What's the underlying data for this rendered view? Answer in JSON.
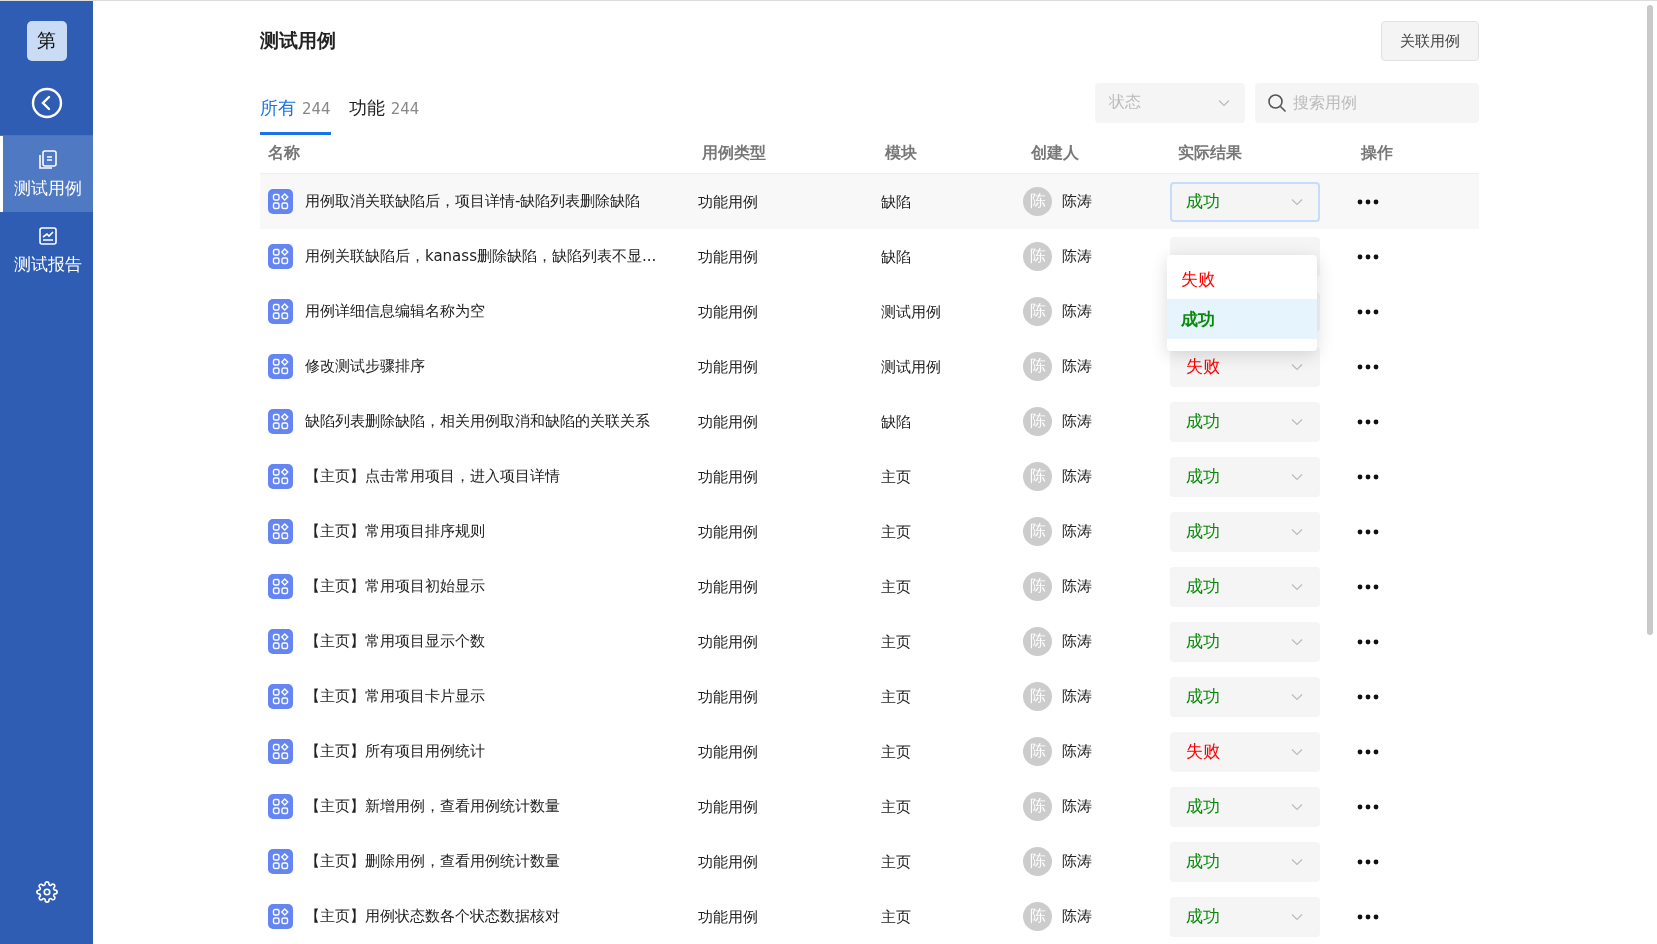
{
  "sidebar": {
    "logo": "第",
    "items": [
      {
        "label": "测试用例",
        "selected": true
      },
      {
        "label": "测试报告",
        "selected": false
      }
    ]
  },
  "header": {
    "title": "测试用例",
    "button": "关联用例"
  },
  "tabs": [
    {
      "label": "所有",
      "count": "244",
      "selected": true
    },
    {
      "label": "功能",
      "count": "244",
      "selected": false
    }
  ],
  "filters": {
    "status": {
      "placeholder": "状态"
    },
    "search": {
      "placeholder": "搜索用例"
    }
  },
  "table": {
    "columns": [
      "名称",
      "用例类型",
      "模块",
      "创建人",
      "实际结果",
      "操作"
    ],
    "rows": [
      {
        "name": "用例取消关联缺陷后，项目详情-缺陷列表删除缺陷",
        "type": "功能用例",
        "module": "缺陷",
        "avatar": "陈",
        "creator": "陈涛",
        "result": {
          "label": "成功",
          "kind": "success"
        },
        "active": true
      },
      {
        "name": "用例关联缺陷后，kanass删除缺陷，缺陷列表不显...",
        "type": "功能用例",
        "module": "缺陷",
        "avatar": "陈",
        "creator": "陈涛",
        "active": false
      },
      {
        "name": "用例详细信息编辑名称为空",
        "type": "功能用例",
        "module": "测试用例",
        "avatar": "陈",
        "creator": "陈涛",
        "active": false
      },
      {
        "name": "修改测试步骤排序",
        "type": "功能用例",
        "module": "测试用例",
        "avatar": "陈",
        "creator": "陈涛",
        "result": {
          "label": "失败",
          "kind": "fail"
        },
        "active": false
      },
      {
        "name": "缺陷列表删除缺陷，相关用例取消和缺陷的关联关系",
        "type": "功能用例",
        "module": "缺陷",
        "avatar": "陈",
        "creator": "陈涛",
        "result": {
          "label": "成功",
          "kind": "success"
        },
        "active": false
      },
      {
        "name": "【主页】点击常用项目，进入项目详情",
        "type": "功能用例",
        "module": "主页",
        "avatar": "陈",
        "creator": "陈涛",
        "result": {
          "label": "成功",
          "kind": "success"
        },
        "active": false
      },
      {
        "name": "【主页】常用项目排序规则",
        "type": "功能用例",
        "module": "主页",
        "avatar": "陈",
        "creator": "陈涛",
        "result": {
          "label": "成功",
          "kind": "success"
        },
        "active": false
      },
      {
        "name": "【主页】常用项目初始显示",
        "type": "功能用例",
        "module": "主页",
        "avatar": "陈",
        "creator": "陈涛",
        "result": {
          "label": "成功",
          "kind": "success"
        },
        "active": false
      },
      {
        "name": "【主页】常用项目显示个数",
        "type": "功能用例",
        "module": "主页",
        "avatar": "陈",
        "creator": "陈涛",
        "result": {
          "label": "成功",
          "kind": "success"
        },
        "active": false
      },
      {
        "name": "【主页】常用项目卡片显示",
        "type": "功能用例",
        "module": "主页",
        "avatar": "陈",
        "creator": "陈涛",
        "result": {
          "label": "成功",
          "kind": "success"
        },
        "active": false
      },
      {
        "name": "【主页】所有项目用例统计",
        "type": "功能用例",
        "module": "主页",
        "avatar": "陈",
        "creator": "陈涛",
        "result": {
          "label": "失败",
          "kind": "fail"
        },
        "active": false
      },
      {
        "name": "【主页】新增用例，查看用例统计数量",
        "type": "功能用例",
        "module": "主页",
        "avatar": "陈",
        "creator": "陈涛",
        "result": {
          "label": "成功",
          "kind": "success"
        },
        "active": false
      },
      {
        "name": "【主页】删除用例，查看用例统计数量",
        "type": "功能用例",
        "module": "主页",
        "avatar": "陈",
        "creator": "陈涛",
        "result": {
          "label": "成功",
          "kind": "success"
        },
        "active": false
      },
      {
        "name": "【主页】用例状态数各个状态数据核对",
        "type": "功能用例",
        "module": "主页",
        "avatar": "陈",
        "creator": "陈涛",
        "result": {
          "label": "成功",
          "kind": "success"
        },
        "active": false
      }
    ]
  },
  "dropdown": {
    "options": [
      {
        "label": "失败",
        "kind": "fail",
        "selected": false
      },
      {
        "label": "成功",
        "kind": "success",
        "selected": true
      }
    ]
  }
}
